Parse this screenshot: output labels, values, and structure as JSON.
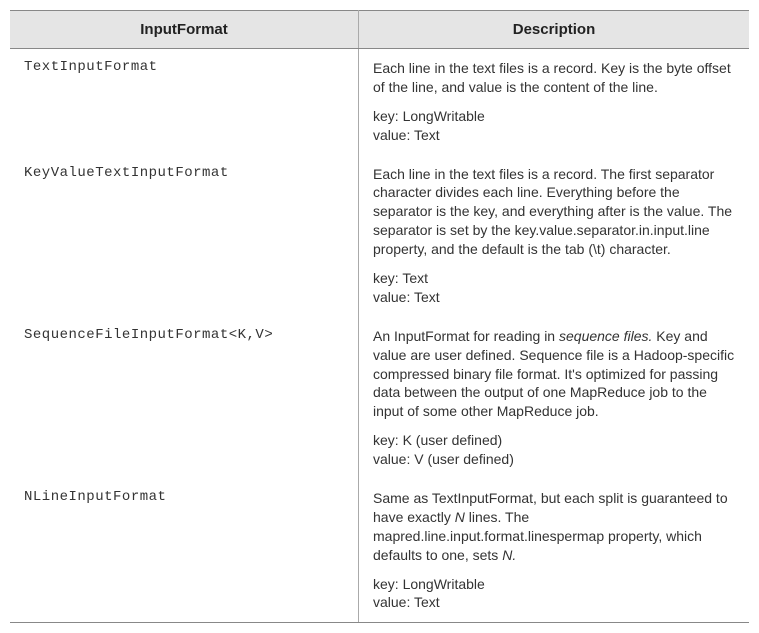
{
  "headers": {
    "col1": "InputFormat",
    "col2": "Description"
  },
  "rows": [
    {
      "format": "TextInputFormat",
      "desc_pre": "Each line in the text files is a record. Key is the byte offset of the line, and value is the content of the line.",
      "desc_ital": "",
      "desc_post": "",
      "key_label": "key: LongWritable",
      "value_label": "value: Text"
    },
    {
      "format": "KeyValueTextInputFormat",
      "desc_pre": "Each line in the text files is a record. The first separator character divides each line. Everything before the separator is the key, and everything after is the value. The separator is set by the key.value.separator.in.input.line property, and the default is the tab (\\t) character.",
      "desc_ital": "",
      "desc_post": "",
      "key_label": "key: Text",
      "value_label": "value: Text"
    },
    {
      "format": "SequenceFileInputFormat<K,V>",
      "desc_pre": "An InputFormat for reading in ",
      "desc_ital": "sequence files.",
      "desc_post": " Key and value are user defined. Sequence file is a Hadoop-specific compressed binary file format. It's optimized for passing data between the output of one MapReduce job to the input of some other MapReduce job.",
      "key_label": "key: K (user defined)",
      "value_label": "value: V (user defined)"
    },
    {
      "format": "NLineInputFormat",
      "desc_pre": "Same as TextInputFormat, but each split is guaranteed to have exactly ",
      "desc_ital": "N",
      "desc_post_pre": " lines. The mapred.line.input.format.linespermap property, which defaults to one, sets ",
      "desc_ital2": "N.",
      "desc_post": "",
      "key_label": "key: LongWritable",
      "value_label": "value: Text"
    }
  ]
}
